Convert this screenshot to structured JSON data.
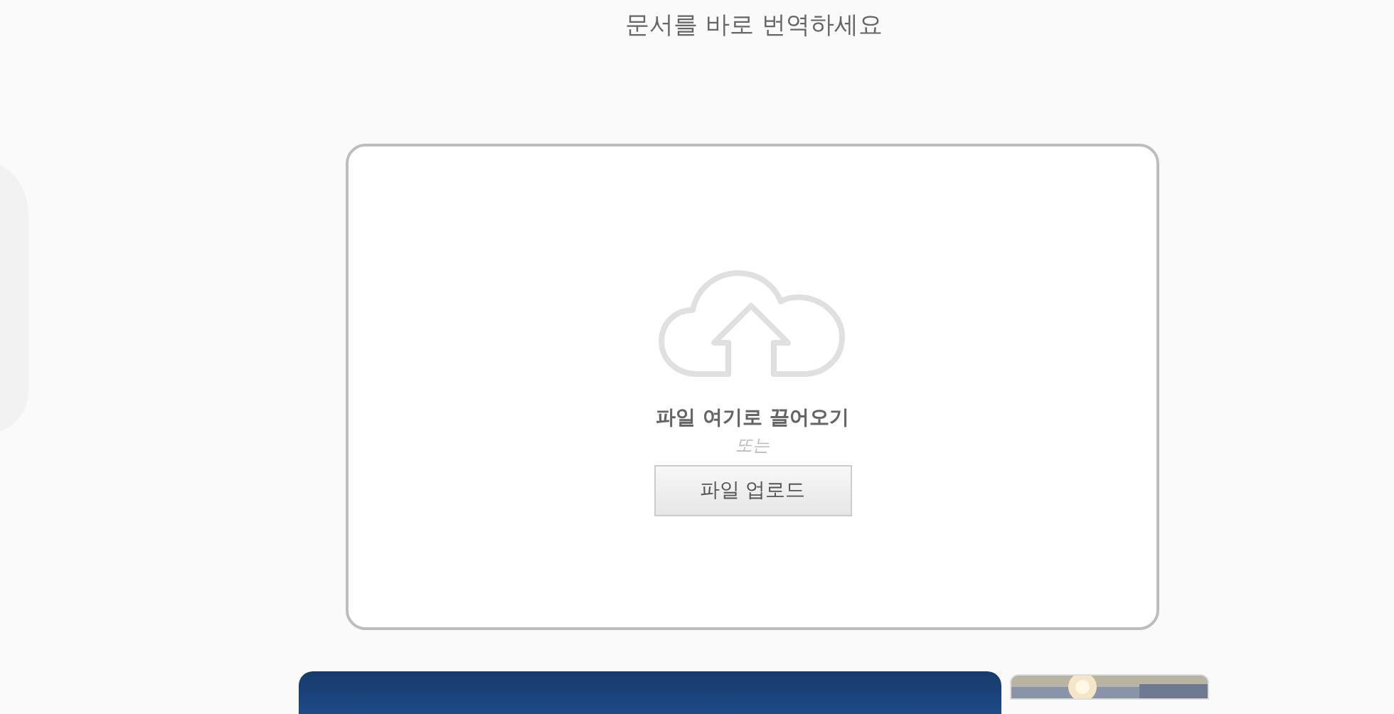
{
  "heading": "문서를 바로 번역하세요",
  "dropzone": {
    "prompt": "파일 여기로 끌어오기",
    "separator": "또는",
    "button": "파일 업로드"
  },
  "ads": [
    {
      "kind": "banner"
    },
    {
      "kind": "picture"
    }
  ]
}
